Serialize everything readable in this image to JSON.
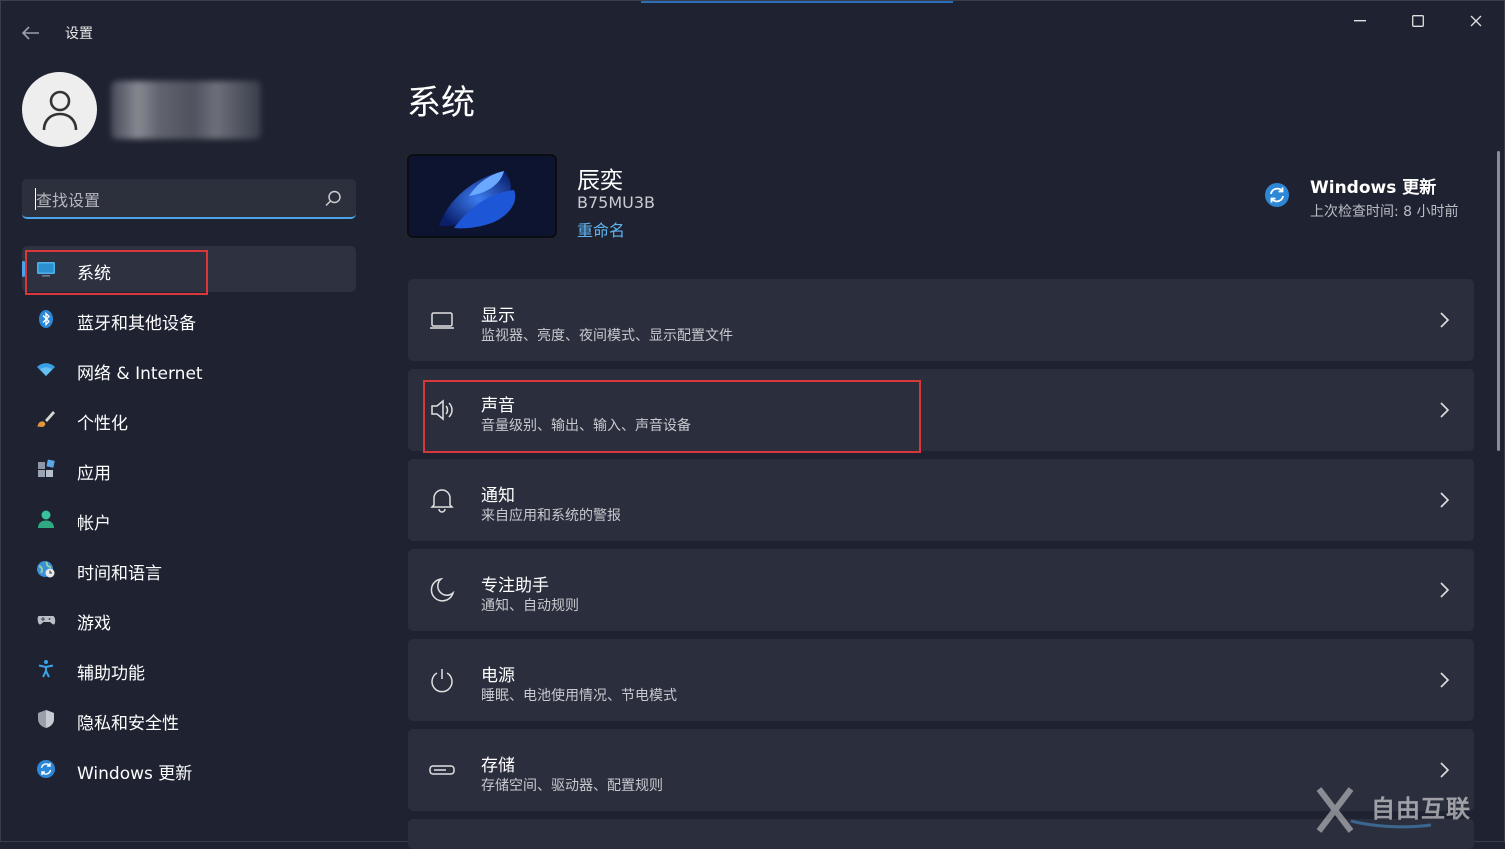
{
  "window": {
    "title": "设置",
    "controls": {
      "minimize_icon": "minimize-icon",
      "maximize_icon": "maximize-icon",
      "close_icon": "close-icon"
    }
  },
  "sidebar": {
    "search_placeholder": "查找设置",
    "items": [
      {
        "label": "系统",
        "icon": "monitor-icon",
        "active": true
      },
      {
        "label": "蓝牙和其他设备",
        "icon": "bluetooth-icon"
      },
      {
        "label": "网络 & Internet",
        "icon": "wifi-icon"
      },
      {
        "label": "个性化",
        "icon": "brush-icon"
      },
      {
        "label": "应用",
        "icon": "apps-icon"
      },
      {
        "label": "帐户",
        "icon": "person-icon"
      },
      {
        "label": "时间和语言",
        "icon": "globe-clock-icon"
      },
      {
        "label": "游戏",
        "icon": "gamepad-icon"
      },
      {
        "label": "辅助功能",
        "icon": "accessibility-icon"
      },
      {
        "label": "隐私和安全性",
        "icon": "shield-icon"
      },
      {
        "label": "Windows 更新",
        "icon": "windows-update-icon"
      }
    ]
  },
  "main": {
    "title": "系统",
    "device": {
      "name": "辰奕",
      "model": "B75MU3B",
      "rename_label": "重命名"
    },
    "windows_update": {
      "title": "Windows 更新",
      "subtitle": "上次检查时间: 8 小时前"
    },
    "cards": [
      {
        "title": "显示",
        "subtitle": "监视器、亮度、夜间模式、显示配置文件",
        "icon": "display-icon"
      },
      {
        "title": "声音",
        "subtitle": "音量级别、输出、输入、声音设备",
        "icon": "speaker-icon"
      },
      {
        "title": "通知",
        "subtitle": "来自应用和系统的警报",
        "icon": "bell-icon"
      },
      {
        "title": "专注助手",
        "subtitle": "通知、自动规则",
        "icon": "moon-icon"
      },
      {
        "title": "电源",
        "subtitle": "睡眠、电池使用情况、节电模式",
        "icon": "power-icon"
      },
      {
        "title": "存储",
        "subtitle": "存储空间、驱动器、配置规则",
        "icon": "storage-icon"
      }
    ]
  },
  "watermark": {
    "text": "自由互联"
  },
  "colors": {
    "accent": "#4aa3e8",
    "highlight_box": "#d9373a",
    "background": "#1f2331",
    "card": "#2b2f3d"
  }
}
